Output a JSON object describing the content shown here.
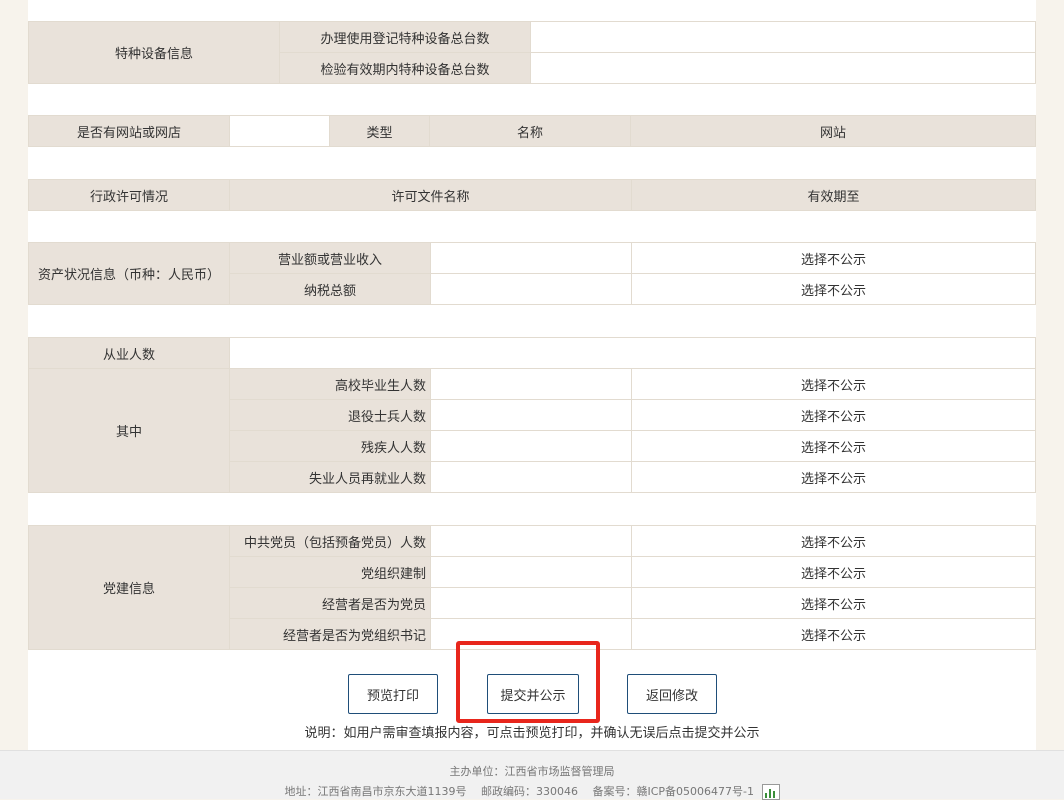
{
  "special_equipment": {
    "label": "特种设备信息",
    "rows": [
      "办理使用登记特种设备总台数",
      "检验有效期内特种设备总台数"
    ]
  },
  "website": {
    "label": "是否有网站或网店",
    "col_type": "类型",
    "col_name": "名称",
    "col_site": "网站"
  },
  "license": {
    "label": "行政许可情况",
    "col_doc": "许可文件名称",
    "col_valid": "有效期至"
  },
  "assets": {
    "label": "资产状况信息（币种：人民币）",
    "rows": [
      {
        "name": "营业额或营业收入",
        "status": "选择不公示"
      },
      {
        "name": "纳税总额",
        "status": "选择不公示"
      }
    ]
  },
  "employees": {
    "label": "从业人数",
    "sub_label": "其中",
    "rows": [
      {
        "name": "高校毕业生人数",
        "status": "选择不公示"
      },
      {
        "name": "退役士兵人数",
        "status": "选择不公示"
      },
      {
        "name": "残疾人人数",
        "status": "选择不公示"
      },
      {
        "name": "失业人员再就业人数",
        "status": "选择不公示"
      }
    ]
  },
  "party": {
    "label": "党建信息",
    "rows": [
      {
        "name": "中共党员（包括预备党员）人数",
        "status": "选择不公示"
      },
      {
        "name": "党组织建制",
        "status": "选择不公示"
      },
      {
        "name": "经营者是否为党员",
        "status": "选择不公示"
      },
      {
        "name": "经营者是否为党组织书记",
        "status": "选择不公示"
      }
    ]
  },
  "actions": {
    "preview": "预览打印",
    "submit": "提交并公示",
    "back": "返回修改",
    "note": "说明：如用户需审查填报内容，可点击预览打印，并确认无误后点击提交并公示"
  },
  "footer": {
    "sponsor": "主办单位：江西省市场监督管理局",
    "address": "地址：江西省南昌市京东大道1139号　 邮政编码：330046　 备案号：赣ICP备05006477号-1"
  },
  "colors": {
    "label_bg": "#e9e2da",
    "highlight": "#e8261c",
    "button_border": "#1f4e79"
  }
}
